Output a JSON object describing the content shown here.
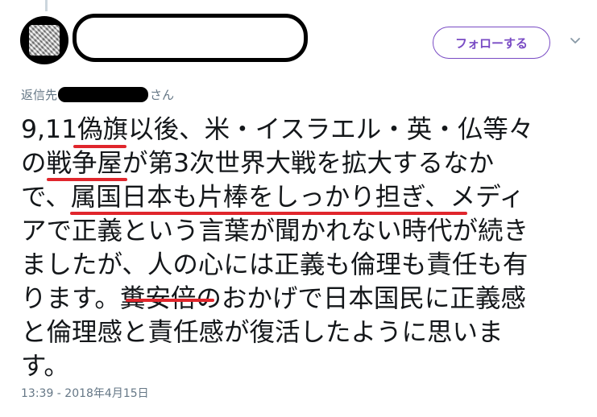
{
  "header": {
    "follow_label": "フォローする"
  },
  "reply_context": {
    "prefix": "返信先",
    "suffix": "さん"
  },
  "tweet": {
    "lines": [
      "9,11偽旗以後、米・イスラエル・英・仏等々",
      "の戦争屋が第3次世界大戦を拡大するなか",
      "で、属国日本も片棒をしっかり担ぎ、メディ",
      "アで正義という言葉が聞かれない時代が続き",
      "ましたが、人の心には正義も倫理も責任も有",
      "ります。糞安倍のおかげで日本国民に正義感",
      "と倫理感と責任感が復活したように思いま",
      "す。"
    ],
    "timestamp": "13:39 - 2018年4月15日"
  },
  "colors": {
    "accent": "#794bc4",
    "meta_text": "#657786",
    "underline": "#e0262c"
  }
}
